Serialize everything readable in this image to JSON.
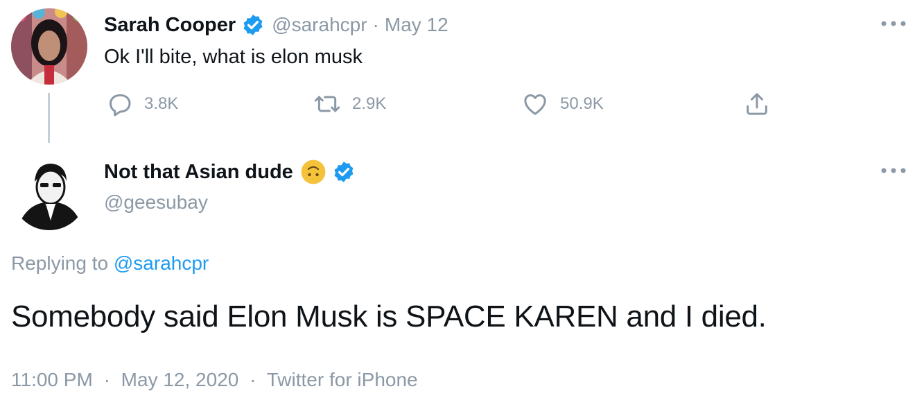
{
  "parent_tweet": {
    "author_name": "Sarah Cooper",
    "author_handle": "@sarahcpr",
    "separator": "·",
    "date": "May 12",
    "text": "Ok I'll bite, what is elon musk",
    "reply_count": "3.8K",
    "retweet_count": "2.9K",
    "like_count": "50.9K"
  },
  "reply_tweet": {
    "author_name": "Not that Asian dude",
    "author_handle": "@geesubay",
    "replying_prefix": "Replying to",
    "replying_to": "@sarahcpr",
    "text": "Somebody said Elon Musk is SPACE KAREN and I died.",
    "time": "11:00 PM",
    "date": "May 12, 2020",
    "source": "Twitter for iPhone",
    "separator": "·"
  },
  "icons": {
    "verified": "verified-badge-icon",
    "reply": "reply-icon",
    "retweet": "retweet-icon",
    "like": "heart-icon",
    "share": "share-icon",
    "more": "more-icon",
    "emoji": "upside-down-face-emoji"
  },
  "colors": {
    "accent": "#1d9bf0",
    "text": "#0f1419",
    "secondary": "#8b98a5",
    "thread_line": "#c4cfd6"
  }
}
